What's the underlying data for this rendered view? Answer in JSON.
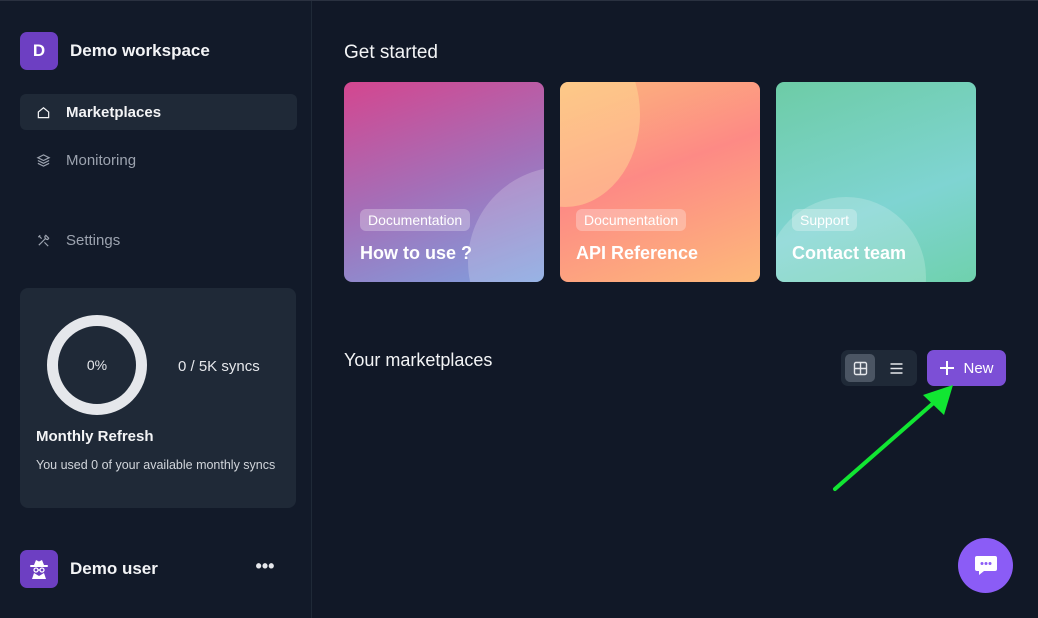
{
  "workspace": {
    "initial": "D",
    "name": "Demo workspace"
  },
  "nav": {
    "marketplaces": "Marketplaces",
    "monitoring": "Monitoring",
    "settings": "Settings"
  },
  "usage": {
    "percent_label": "0%",
    "percent": 0,
    "syncs": "0 / 5K syncs",
    "title": "Monthly Refresh",
    "description": "You used 0 of your available monthly syncs"
  },
  "user": {
    "name": "Demo user",
    "menu": "•••"
  },
  "main": {
    "get_started": "Get started",
    "cards": [
      {
        "tag": "Documentation",
        "title": "How to use ?"
      },
      {
        "tag": "Documentation",
        "title": "API Reference"
      },
      {
        "tag": "Support",
        "title": "Contact team"
      }
    ],
    "marketplaces_title": "Your marketplaces",
    "new_label": "New"
  },
  "colors": {
    "background": "#111827",
    "sidebar": "#121a29",
    "accent": "#7c4fd6",
    "arrow": "#11e632"
  },
  "icons": {
    "nav": [
      "home-icon",
      "layers-icon",
      "tools-icon"
    ],
    "view": [
      "grid-icon",
      "list-icon"
    ],
    "new": "plus-icon",
    "chat": "chat-icon",
    "user": "spy-icon"
  }
}
